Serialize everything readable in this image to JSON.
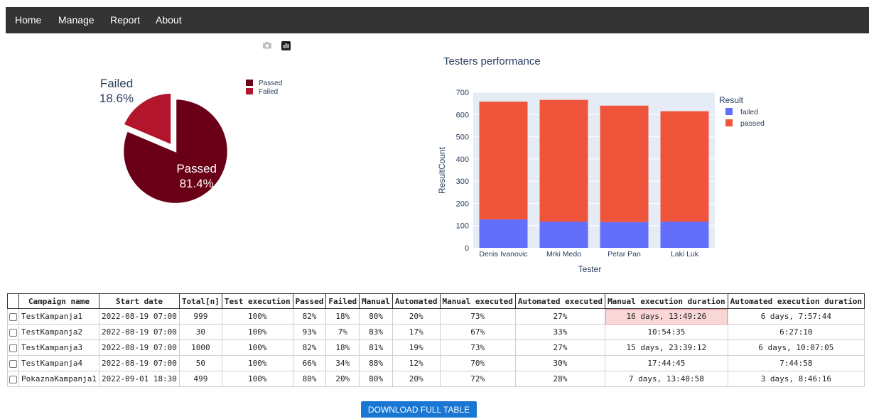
{
  "nav": {
    "items": [
      {
        "label": "Home"
      },
      {
        "label": "Manage"
      },
      {
        "label": "Report"
      },
      {
        "label": "About"
      }
    ]
  },
  "modebar": {
    "icons": [
      "camera-icon",
      "plotly-logo-icon"
    ]
  },
  "chart_data": [
    {
      "type": "pie",
      "labels": [
        "Passed",
        "Failed"
      ],
      "values": [
        81.4,
        18.6
      ],
      "slice_labels": [
        [
          "Passed",
          "81.4%"
        ],
        [
          "Failed",
          "18.6%"
        ]
      ],
      "colors": [
        "#6a0018",
        "#b3162c"
      ],
      "legend": {
        "entries": [
          "Passed",
          "Failed"
        ],
        "position": "top-right"
      },
      "pulled_slice": "Failed"
    },
    {
      "type": "bar",
      "stacked": true,
      "title": "Testers performance",
      "xlabel": "Tester",
      "ylabel": "ResultCount",
      "categories": [
        "Denis Ivanovic",
        "Mrki Medo",
        "Petar Pan",
        "Laki Luk"
      ],
      "series": [
        {
          "name": "failed",
          "values": [
            128,
            118,
            116,
            118
          ],
          "color": "#636efa"
        },
        {
          "name": "passed",
          "values": [
            530,
            548,
            524,
            497
          ],
          "color": "#ef553b"
        }
      ],
      "ylim": [
        0,
        700
      ],
      "yticks": [
        0,
        100,
        200,
        300,
        400,
        500,
        600,
        700
      ],
      "legend": {
        "title": "Result",
        "position": "top-right"
      },
      "plot_background": "#e5ecf6",
      "grid": true
    }
  ],
  "table": {
    "headers": [
      "Campaign name",
      "Start date",
      "Total[n]",
      "Test execution",
      "Passed",
      "Failed",
      "Manual",
      "Automated",
      "Manual executed",
      "Automated executed",
      "Manual execution duration",
      "Automated execution duration"
    ],
    "rows": [
      [
        "TestKampanja1",
        "2022-08-19 07:00",
        "999",
        "100%",
        "82%",
        "18%",
        "80%",
        "20%",
        "73%",
        "27%",
        "16 days, 13:49:26",
        "6 days, 7:57:44"
      ],
      [
        "TestKampanja2",
        "2022-08-19 07:00",
        "30",
        "100%",
        "93%",
        "7%",
        "83%",
        "17%",
        "67%",
        "33%",
        "10:54:35",
        "6:27:10"
      ],
      [
        "TestKampanja3",
        "2022-08-19 07:00",
        "1000",
        "100%",
        "82%",
        "18%",
        "81%",
        "19%",
        "73%",
        "27%",
        "15 days, 23:39:12",
        "6 days, 10:07:05"
      ],
      [
        "TestKampanja4",
        "2022-08-19 07:00",
        "50",
        "100%",
        "66%",
        "34%",
        "88%",
        "12%",
        "70%",
        "30%",
        "17:44:45",
        "7:44:58"
      ],
      [
        "PokaznaKampanja1",
        "2022-09-01 18:30",
        "499",
        "100%",
        "80%",
        "20%",
        "80%",
        "20%",
        "72%",
        "28%",
        "7 days, 13:40:58",
        "3 days, 8:46:16"
      ]
    ],
    "highlighted_cell": {
      "row": 0,
      "col": 10,
      "color": "#f9d7d7"
    }
  },
  "download_label": "DOWNLOAD FULL TABLE",
  "colors": {
    "navbar": "#333333",
    "download_button": "#1976d2"
  }
}
